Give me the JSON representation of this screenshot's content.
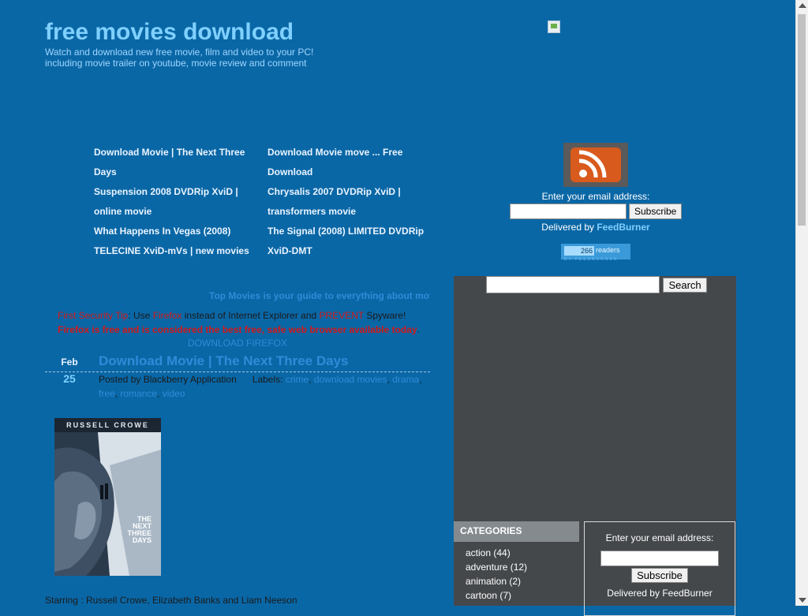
{
  "header": {
    "site_title": "free movies download",
    "tagline": "Watch and download new free movie, film and video to your PC! including movie trailer on youtube, movie review and comment"
  },
  "nav": {
    "left": [
      "Download Movie | The Next Three Days",
      "Suspension 2008 DVDRip XviD | online movie",
      "What Happens In Vegas (2008) TELECINE XviD-mVs | new movies"
    ],
    "right": [
      "Download Movie move ... Free Download",
      "Chrysalis 2007 DVDRip XviD | transformers movie",
      "The Signal (2008) LIMITED DVDRip XviD-DMT"
    ]
  },
  "feed": {
    "email_label": "Enter your email address:",
    "email_value": "",
    "subscribe_label": "Subscribe",
    "delivered_by": "Delivered by",
    "feedburner": "FeedBurner",
    "readers_count": "266",
    "readers_word": "readers",
    "readers_foot": "BY FEEDBURNER"
  },
  "sidebar": {
    "search_value": "",
    "search_label": "Search",
    "categories_title": "CATEGORIES",
    "categories": [
      "action (44)",
      "adventure (12)",
      "animation (2)",
      "cartoon (7)"
    ],
    "subscribe": {
      "email_label": "Enter your email address:",
      "email_value": "",
      "button": "Subscribe",
      "delivered_by": "Delivered by",
      "feedburner": "FeedBurner"
    }
  },
  "main": {
    "guide_text": "Top Movies is your guide to everything about mov",
    "security": {
      "lead": "First Security Tip",
      "colon": ":",
      "use": " Use ",
      "firefox": "Firefox",
      "instead": " instead of Internet Explorer and ",
      "prevent": "PREVENT",
      "spyware": " Spyware!",
      "bold_line": "Firefox is free and is considered the best free, safe web browser available today",
      "period": "."
    },
    "download_firefox": "DOWNLOAD FIREFOX",
    "post": {
      "month": "Feb",
      "day": "25",
      "title": "Download Movie | The Next Three Days",
      "posted_by": "Posted by Blackberry Application",
      "labels_prefix": "Labels:",
      "labels": [
        "crime",
        "download movies",
        "drama",
        "free",
        "romance",
        "video"
      ],
      "poster_actor": "RUSSELL CROWE",
      "poster_title_1": "THE",
      "poster_title_2": "NEXT",
      "poster_title_3": "THREE",
      "poster_title_4": "DAYS",
      "starring": "Starring : Russell Crowe, Elizabeth Banks and Liam Neeson"
    }
  }
}
